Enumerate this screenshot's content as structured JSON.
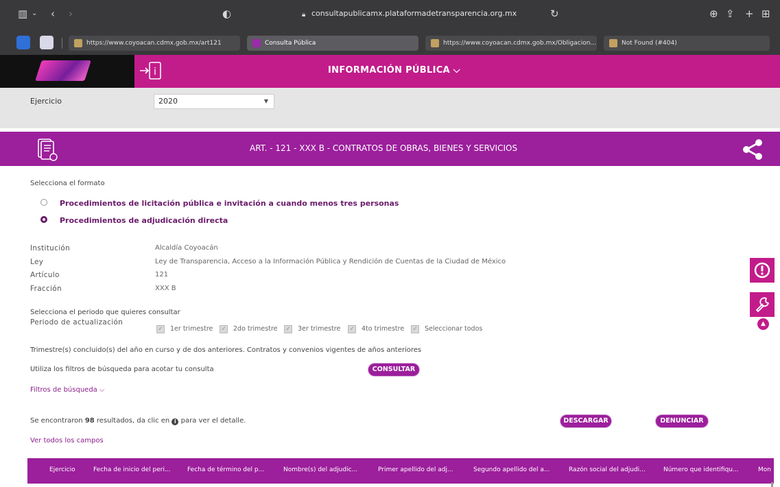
{
  "browser": {
    "url": "consultapublicamx.plataformadetransparencia.org.mx",
    "tabs": [
      {
        "label": "https://www.coyoacan.cdmx.gob.mx/art121",
        "active": false
      },
      {
        "label": "Consulta Pública",
        "active": true
      },
      {
        "label": "https://www.coyoacan.cdmx.gob.mx/Obligacion...",
        "active": false
      },
      {
        "label": "Not Found (#404)",
        "active": false
      }
    ]
  },
  "header": {
    "title": "INFORMACIÓN PÚBLICA ⌵"
  },
  "ejercicio": {
    "label": "Ejercicio",
    "selected": "2020"
  },
  "article": {
    "title": "ART. - 121 - XXX B - CONTRATOS DE OBRAS, BIENES Y SERVICIOS"
  },
  "format": {
    "prompt": "Selecciona el formato",
    "options": [
      {
        "label": "Procedimientos de licitación pública e invitación a cuando menos tres personas",
        "selected": false
      },
      {
        "label": "Procedimientos de adjudicación directa",
        "selected": true
      }
    ]
  },
  "info": {
    "institucion_label": "Institución",
    "institucion_value": "Alcaldía Coyoacán",
    "ley_label": "Ley",
    "ley_value": "Ley de Transparencia, Acceso a la Información Pública y Rendición de Cuentas de la Ciudad de México",
    "articulo_label": "Artículo",
    "articulo_value": "121",
    "fraccion_label": "Fracción",
    "fraccion_value": "XXX B"
  },
  "periodo": {
    "prompt": "Selecciona el periodo que quieres consultar",
    "label": "Periodo de actualización",
    "options": [
      "1er trimestre",
      "2do trimestre",
      "3er trimestre",
      "4to trimestre",
      "Seleccionar todos"
    ]
  },
  "notes": {
    "trimestres": "Trimestre(s) concluido(s) del año en curso y de dos anteriores. Contratos y convenios vigentes de años anteriores",
    "filtros_hint": "Utiliza los filtros de búsqueda para acotar tu consulta",
    "consultar": "CONSULTAR",
    "filtros_link": "Filtros de búsqueda ⌵"
  },
  "results": {
    "prefix": "Se encontraron ",
    "count": "98",
    "suffix_before_icon": " resultados, da clic en ",
    "suffix_after_icon": " para ver el detalle.",
    "descargar": "DESCARGAR",
    "denunciar": "DENUNCIAR",
    "ver_todos": "Ver todos los campos"
  },
  "table": {
    "columns": [
      "Ejercicio",
      "Fecha de inicio del peri...",
      "Fecha de término del p...",
      "Nombre(s) del adjudic...",
      "Primer apellido del adj...",
      "Segundo apellido del a...",
      "Razón social del adjudi...",
      "Número que identifiqu...",
      "Mon"
    ]
  },
  "colors": {
    "magenta": "#c21c8a",
    "purple": "#9c1f9c",
    "dark_purple": "#6a1b6a"
  }
}
